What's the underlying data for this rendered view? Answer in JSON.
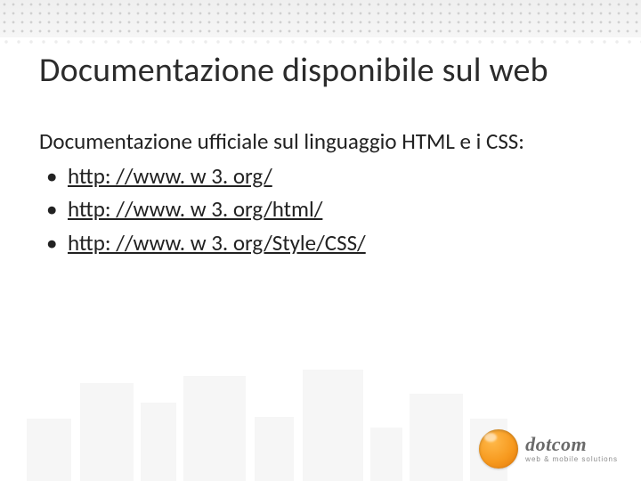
{
  "title": "Documentazione disponibile sul web",
  "intro": "Documentazione ufficiale sul linguaggio HTML e i CSS:",
  "links": [
    "http: //www. w 3. org/",
    "http: //www. w 3. org/html/",
    "http: //www. w 3. org/Style/CSS/"
  ],
  "logo": {
    "brand": "dotcom",
    "tagline": "web & mobile solutions"
  }
}
